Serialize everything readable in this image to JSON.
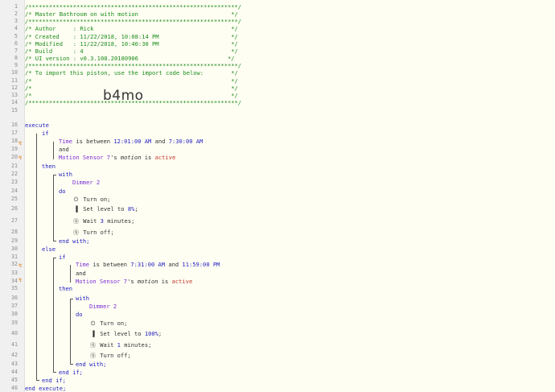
{
  "line_numbers": [
    "1",
    "2",
    "3",
    "4",
    "5",
    "6",
    "7",
    "8",
    "9",
    "10",
    "11",
    "12",
    "13",
    "14",
    "15",
    "16",
    "17",
    "18",
    "19",
    "20",
    "21",
    "22",
    "23",
    "24",
    "25",
    "26",
    "27",
    "28",
    "29",
    "30",
    "31",
    "32",
    "33",
    "34",
    "35",
    "36",
    "37",
    "38",
    "39",
    "40",
    "41",
    "42",
    "43",
    "44",
    "45",
    "46"
  ],
  "header": {
    "stars": "/*************************************************************/",
    "title": "/* Master Bathroom on with motion                           */",
    "author": "/* Author     : Rick                                        */",
    "created": "/* Created    : 11/22/2018, 10:08:14 PM                     */",
    "modified": "/* Modified   : 11/22/2018, 10:40:30 PM                     */",
    "build": "/* Build      : 4                                           */",
    "ui_version": "/* UI version : v0.3.108.20180906                          */",
    "import_note": "/* To import this piston, use the import code below:        */",
    "blank": "/*                                                          */",
    "import_code": "b4mo"
  },
  "kw": {
    "execute": "execute",
    "if": "if",
    "and": "and",
    "then": "then",
    "with": "with",
    "do": "do",
    "else": "else",
    "end_with": "end with;",
    "end_if": "end if;",
    "end_execute": "end execute;",
    "is_between": " is between ",
    "and_mid": " and ",
    "possessive": "'s ",
    "is": " is "
  },
  "cond": {
    "time": "Time",
    "t1_start": "12:01:00 AM",
    "t1_end": "7:30:00 AM",
    "t2_start": "7:31:00 AM",
    "t2_end": "11:59:00 PM",
    "device": "Motion Sensor 7",
    "attr": "motion",
    "state": "active"
  },
  "actions": {
    "dimmer": "Dimmer 2",
    "turn_on": "Turn on;",
    "set_level_prefix": "Set level to ",
    "level1": "8%",
    "level2": "100%",
    "semi": ";",
    "wait_prefix": "Wait ",
    "wait1": "3",
    "wait2": "1",
    "wait_suffix": " minutes;",
    "turn_off": "Turn off;"
  },
  "icons": [
    "power-icon",
    "signal-bars-icon",
    "clock-question-icon",
    "lightning-icon"
  ]
}
